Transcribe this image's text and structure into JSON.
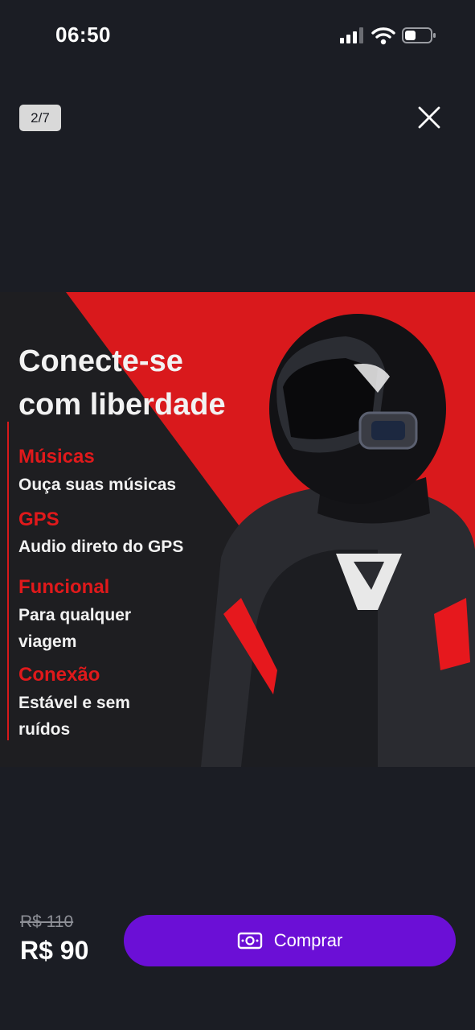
{
  "status_bar": {
    "time": "06:50"
  },
  "viewer": {
    "counter": "2/7"
  },
  "banner": {
    "headline_line1": "Conecte-se",
    "headline_line2": "com liberdade",
    "features": [
      {
        "title": "Músicas",
        "desc": "Ouça suas músicas"
      },
      {
        "title": "GPS",
        "desc": "Audio direto do GPS"
      },
      {
        "title": "Funcional",
        "desc": "Para qualquer viagem"
      },
      {
        "title": "Conexão",
        "desc": "Estável e sem ruídos"
      }
    ],
    "accent_color": "#e0191b"
  },
  "purchase": {
    "old_price": "R$ 110",
    "price": "R$ 90",
    "buy_label": "Comprar",
    "button_color": "#6b0fd6"
  },
  "icons": [
    "signal-icon",
    "wifi-icon",
    "battery-icon",
    "close-icon",
    "money-icon"
  ]
}
